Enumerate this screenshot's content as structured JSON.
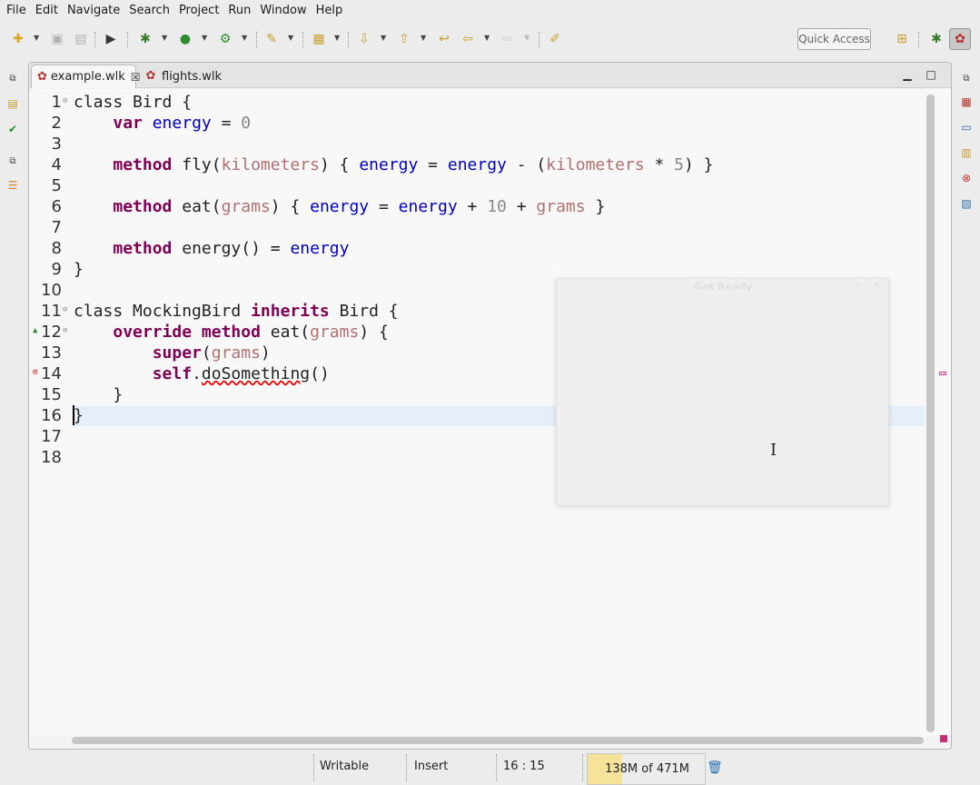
{
  "menu": [
    "File",
    "Edit",
    "Navigate",
    "Search",
    "Project",
    "Run",
    "Window",
    "Help"
  ],
  "toolbar": {
    "quick_access": "Quick Access",
    "icons": [
      "new-icon",
      "save-icon",
      "save-all-icon",
      "terminal-icon",
      "debug-icon",
      "run-icon",
      "external-tools-icon",
      "open-type-icon",
      "open-task-icon",
      "next-annotation-icon",
      "previous-annotation-icon",
      "last-edit-icon",
      "back-icon",
      "forward-icon",
      "pin-editor-icon",
      "open-perspective-icon",
      "debug-perspective-icon",
      "wollok-perspective-icon"
    ]
  },
  "editor": {
    "tabs": [
      {
        "label": "example.wlk",
        "active": true
      },
      {
        "label": "flights.wlk",
        "active": false
      }
    ],
    "lines": [
      {
        "n": "1",
        "fold": true,
        "tokens": [
          [
            "kw_plain",
            "class"
          ],
          [
            "t",
            " Bird {"
          ]
        ]
      },
      {
        "n": "2",
        "tokens": [
          [
            "t",
            "    "
          ],
          [
            "kw",
            "var"
          ],
          [
            "t",
            " "
          ],
          [
            "var",
            "energy"
          ],
          [
            "t",
            " = "
          ],
          [
            "num",
            "0"
          ]
        ]
      },
      {
        "n": "3",
        "tokens": []
      },
      {
        "n": "4",
        "tokens": [
          [
            "t",
            "    "
          ],
          [
            "kw",
            "method"
          ],
          [
            "t",
            " fly("
          ],
          [
            "param",
            "kilometers"
          ],
          [
            "t",
            ") { "
          ],
          [
            "var",
            "energy"
          ],
          [
            "t",
            " = "
          ],
          [
            "var",
            "energy"
          ],
          [
            "t",
            " - ("
          ],
          [
            "param",
            "kilometers"
          ],
          [
            "t",
            " * "
          ],
          [
            "num",
            "5"
          ],
          [
            "t",
            ") }"
          ]
        ]
      },
      {
        "n": "5",
        "tokens": []
      },
      {
        "n": "6",
        "tokens": [
          [
            "t",
            "    "
          ],
          [
            "kw",
            "method"
          ],
          [
            "t",
            " eat("
          ],
          [
            "param",
            "grams"
          ],
          [
            "t",
            ") { "
          ],
          [
            "var",
            "energy"
          ],
          [
            "t",
            " = "
          ],
          [
            "var",
            "energy"
          ],
          [
            "t",
            " + "
          ],
          [
            "num",
            "10"
          ],
          [
            "t",
            " + "
          ],
          [
            "param",
            "grams"
          ],
          [
            "t",
            " }"
          ]
        ]
      },
      {
        "n": "7",
        "tokens": []
      },
      {
        "n": "8",
        "tokens": [
          [
            "t",
            "    "
          ],
          [
            "kw",
            "method"
          ],
          [
            "t",
            " energy() = "
          ],
          [
            "var",
            "energy"
          ]
        ]
      },
      {
        "n": "9",
        "tokens": [
          [
            "t",
            "}"
          ]
        ]
      },
      {
        "n": "10",
        "tokens": []
      },
      {
        "n": "11",
        "fold": true,
        "tokens": [
          [
            "kw_plain",
            "class"
          ],
          [
            "t",
            " MockingBird "
          ],
          [
            "kw",
            "inherits"
          ],
          [
            "t",
            " Bird {"
          ]
        ]
      },
      {
        "n": "12",
        "fold": true,
        "marker": "override",
        "tokens": [
          [
            "t",
            "    "
          ],
          [
            "kw",
            "override"
          ],
          [
            "t",
            " "
          ],
          [
            "kw",
            "method"
          ],
          [
            "t",
            " eat("
          ],
          [
            "param",
            "grams"
          ],
          [
            "t",
            ") {"
          ]
        ]
      },
      {
        "n": "13",
        "tokens": [
          [
            "t",
            "        "
          ],
          [
            "kw",
            "super"
          ],
          [
            "t",
            "("
          ],
          [
            "param",
            "grams"
          ],
          [
            "t",
            ")"
          ]
        ]
      },
      {
        "n": "14",
        "marker": "error",
        "tokens": [
          [
            "t",
            "        "
          ],
          [
            "kw",
            "self"
          ],
          [
            "t",
            "."
          ],
          [
            "err",
            "doSomething"
          ],
          [
            "t",
            "()"
          ]
        ]
      },
      {
        "n": "15",
        "tokens": [
          [
            "t",
            "    }"
          ]
        ]
      },
      {
        "n": "16",
        "tokens": [
          [
            "t",
            "}"
          ]
        ]
      },
      {
        "n": "17",
        "tokens": []
      },
      {
        "n": "18",
        "tokens": []
      }
    ]
  },
  "floating_window": {
    "title": "Get Ready"
  },
  "status": {
    "writable": "Writable",
    "insert_mode": "Insert",
    "position": "16 : 15",
    "heap": "138M of 471M",
    "heap_used_fraction": 0.293
  }
}
